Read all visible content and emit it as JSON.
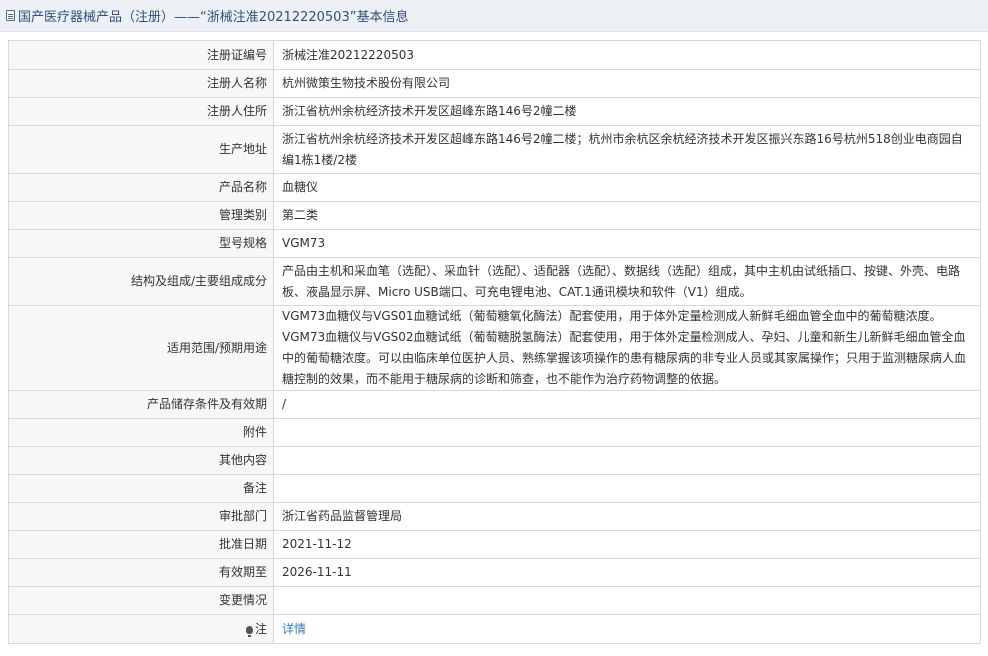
{
  "header": {
    "title": "国产医疗器械产品（注册）——“浙械注准20212220503”基本信息",
    "icon": "document-icon"
  },
  "rows": [
    {
      "label": "注册证编号",
      "value": "浙械注准20212220503"
    },
    {
      "label": "注册人名称",
      "value": "杭州微策生物技术股份有限公司"
    },
    {
      "label": "注册人住所",
      "value": "浙江省杭州余杭经济技术开发区超峰东路146号2幢二楼"
    },
    {
      "label": "生产地址",
      "value": "浙江省杭州余杭经济技术开发区超峰东路146号2幢二楼；杭州市余杭区余杭经济技术开发区振兴东路16号杭州518创业电商园自编1栋1楼/2楼"
    },
    {
      "label": "产品名称",
      "value": "血糖仪"
    },
    {
      "label": "管理类别",
      "value": "第二类"
    },
    {
      "label": "型号规格",
      "value": "VGM73"
    },
    {
      "label": "结构及组成/主要组成成分",
      "value": "产品由主机和采血笔（选配）、采血针（选配）、适配器（选配）、数据线（选配）组成，其中主机由试纸插口、按键、外壳、电路板、液晶显示屏、Micro USB端口、可充电锂电池、CAT.1通讯模块和软件（V1）组成。"
    },
    {
      "label": "适用范围/预期用途",
      "value": "VGM73血糖仪与VGS01血糖试纸（葡萄糖氧化酶法）配套使用，用于体外定量检测成人新鲜毛细血管全血中的葡萄糖浓度。VGM73血糖仪与VGS02血糖试纸（葡萄糖脱氢酶法）配套使用，用于体外定量检测成人、孕妇、儿童和新生儿新鲜毛细血管全血中的葡萄糖浓度。可以由临床单位医护人员、熟练掌握该项操作的患有糖尿病的非专业人员或其家属操作；只用于监测糖尿病人血糖控制的效果，而不能用于糖尿病的诊断和筛查，也不能作为治疗药物调整的依据。"
    },
    {
      "label": "产品储存条件及有效期",
      "value": "/"
    },
    {
      "label": "附件",
      "value": ""
    },
    {
      "label": "其他内容",
      "value": ""
    },
    {
      "label": "备注",
      "value": ""
    },
    {
      "label": "审批部门",
      "value": "浙江省药品监督管理局"
    },
    {
      "label": "批准日期",
      "value": "2021-11-12"
    },
    {
      "label": "有效期至",
      "value": "2026-11-11"
    },
    {
      "label": "变更情况",
      "value": ""
    },
    {
      "label": "注",
      "value": "详情",
      "icon": "lightbulb-icon"
    }
  ]
}
